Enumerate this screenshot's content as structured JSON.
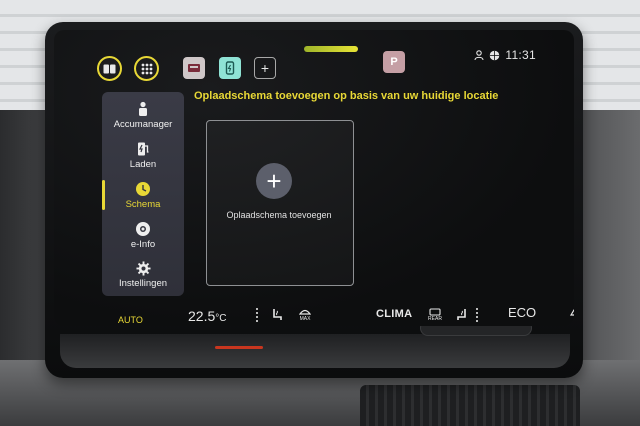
{
  "topbar": {
    "time": "11:31",
    "p_label": "P"
  },
  "sidebar": {
    "items": [
      {
        "label": "Accumanager",
        "icon": "battery-person-icon"
      },
      {
        "label": "Laden",
        "icon": "charging-station-icon"
      },
      {
        "label": "Schema",
        "icon": "clock-schedule-icon",
        "active": true
      },
      {
        "label": "e-Info",
        "icon": "info-globe-icon"
      },
      {
        "label": "Instellingen",
        "icon": "gear-icon"
      }
    ]
  },
  "main": {
    "heading": "Oplaadschema toevoegen op basis van uw huidige locatie",
    "card_label": "Oplaadschema toevoegen"
  },
  "climate": {
    "auto": "AUTO",
    "temperature": "22.5",
    "unit": "°C",
    "clima": "CLIMA",
    "eco": "ECO",
    "max_label": "MAX",
    "rear_label": "REAR"
  },
  "colors": {
    "accent": "#e8d836",
    "sidebar_bg": "#34353f",
    "screen_bg": "#0d0e0f"
  }
}
